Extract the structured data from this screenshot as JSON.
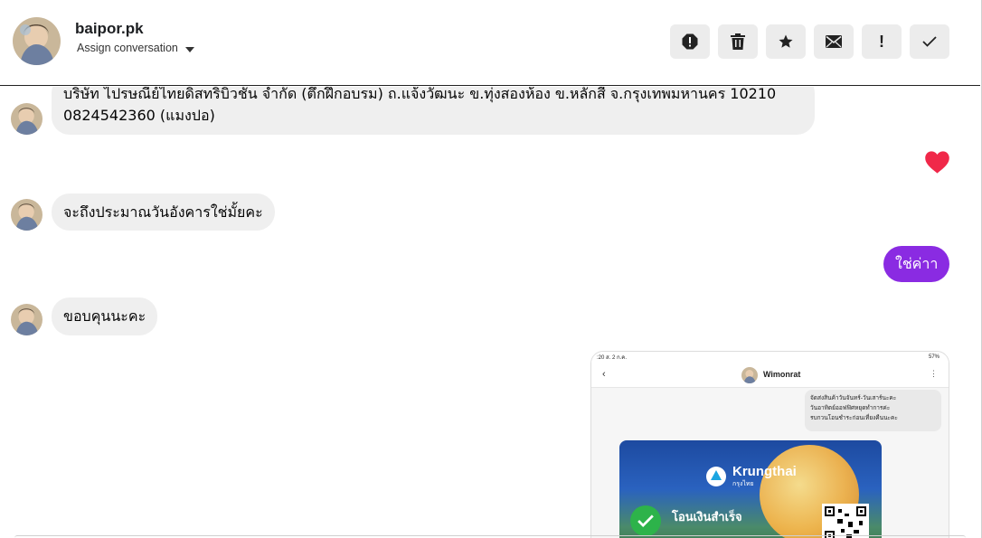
{
  "header": {
    "contact_name": "baipor.pk",
    "assign_label": "Assign conversation",
    "actions": [
      {
        "name": "report-icon"
      },
      {
        "name": "trash-icon"
      },
      {
        "name": "star-icon"
      },
      {
        "name": "mail-icon"
      },
      {
        "name": "exclamation-icon",
        "label": "!"
      },
      {
        "name": "check-icon"
      }
    ]
  },
  "messages": {
    "m1_line1": "บริษัท ไปรษณีย์ไทยดิสทริบิวชั่น จำกัด (ตึกฝึกอบรม) ถ.แจ้งวัฒนะ ข.ทุ่งสองห้อง ข.หลักสี่ จ.กรุงเทพมหานคร 10210",
    "m1_line2": "0824542360 (แมงปอ)",
    "reaction": "heart-icon",
    "m2": "จะถึงประมาณวันอังคารใช่มั้ยคะ",
    "m3_out": "ใช่ค่าา",
    "m4": "ขอบคุนนะคะ"
  },
  "attachment": {
    "status_time": ":20 ส. 2 ก.ค.",
    "status_battery": "57%",
    "back_glyph": "‹",
    "chat_name": "Wimonrat",
    "more_glyph": "⋮",
    "note_line1": "จัดส่งสินค้าวันจันทร์-วันเสาร์นะคะ",
    "note_line2": "วันอาทิตย์ออฟฟิศหยุดทำการค่ะ",
    "note_line3": "รบกวนโอนชำระก่อนเที่ยงคืนนะคะ",
    "bank_name": "Krungthai",
    "bank_name_th": "กรุงไทย",
    "transfer_status": "โอนเงินสำเร็จ"
  },
  "colors": {
    "outgoing_bubble": "#8a2be2",
    "incoming_bubble": "#efefef",
    "heart": "#f02849"
  }
}
